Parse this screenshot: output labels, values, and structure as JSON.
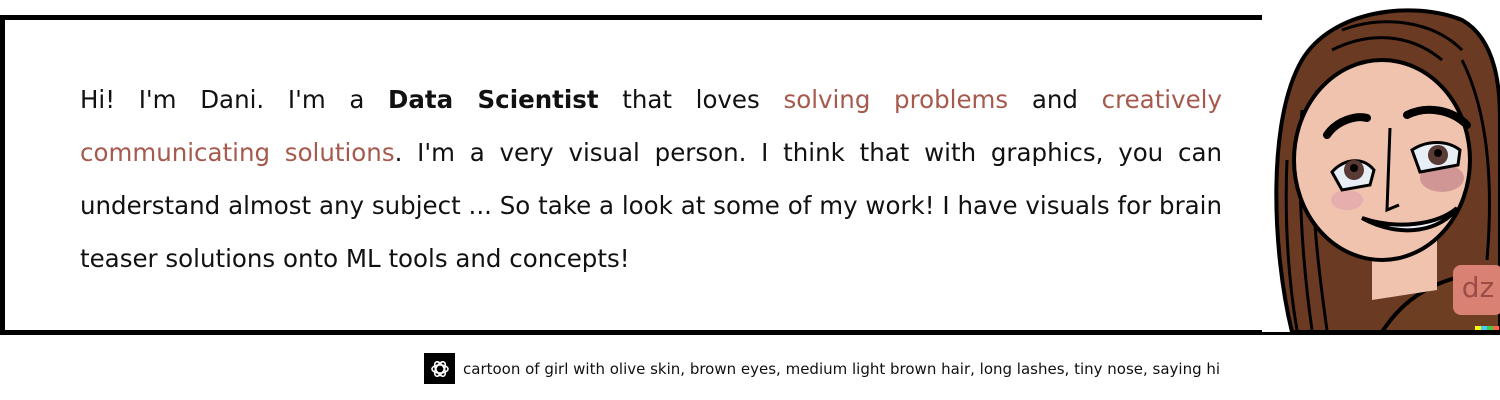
{
  "intro": {
    "p1": "Hi! I'm Dani. I'm a ",
    "role": "Data Scientist",
    "p2": " that loves ",
    "highlight1": "solving problems",
    "p3": " and ",
    "highlight2": "creatively communicating solutions",
    "p4": ". I'm a very visual person. I think that with graphics, you can understand almost any subject ... So take a look at some of my work! I have visuals for brain teaser solutions onto ML tools and concepts!"
  },
  "portrait": {
    "watermark": "dz",
    "icon": "cartoon-portrait"
  },
  "caption": {
    "icon": "openai-logo-icon",
    "text": "cartoon of girl with olive skin, brown eyes, medium light brown hair, long lashes, tiny nose, saying hi"
  },
  "colors": {
    "highlight": "#a65a4e",
    "hair": "#6b3a22",
    "skin": "#efc3ae"
  }
}
